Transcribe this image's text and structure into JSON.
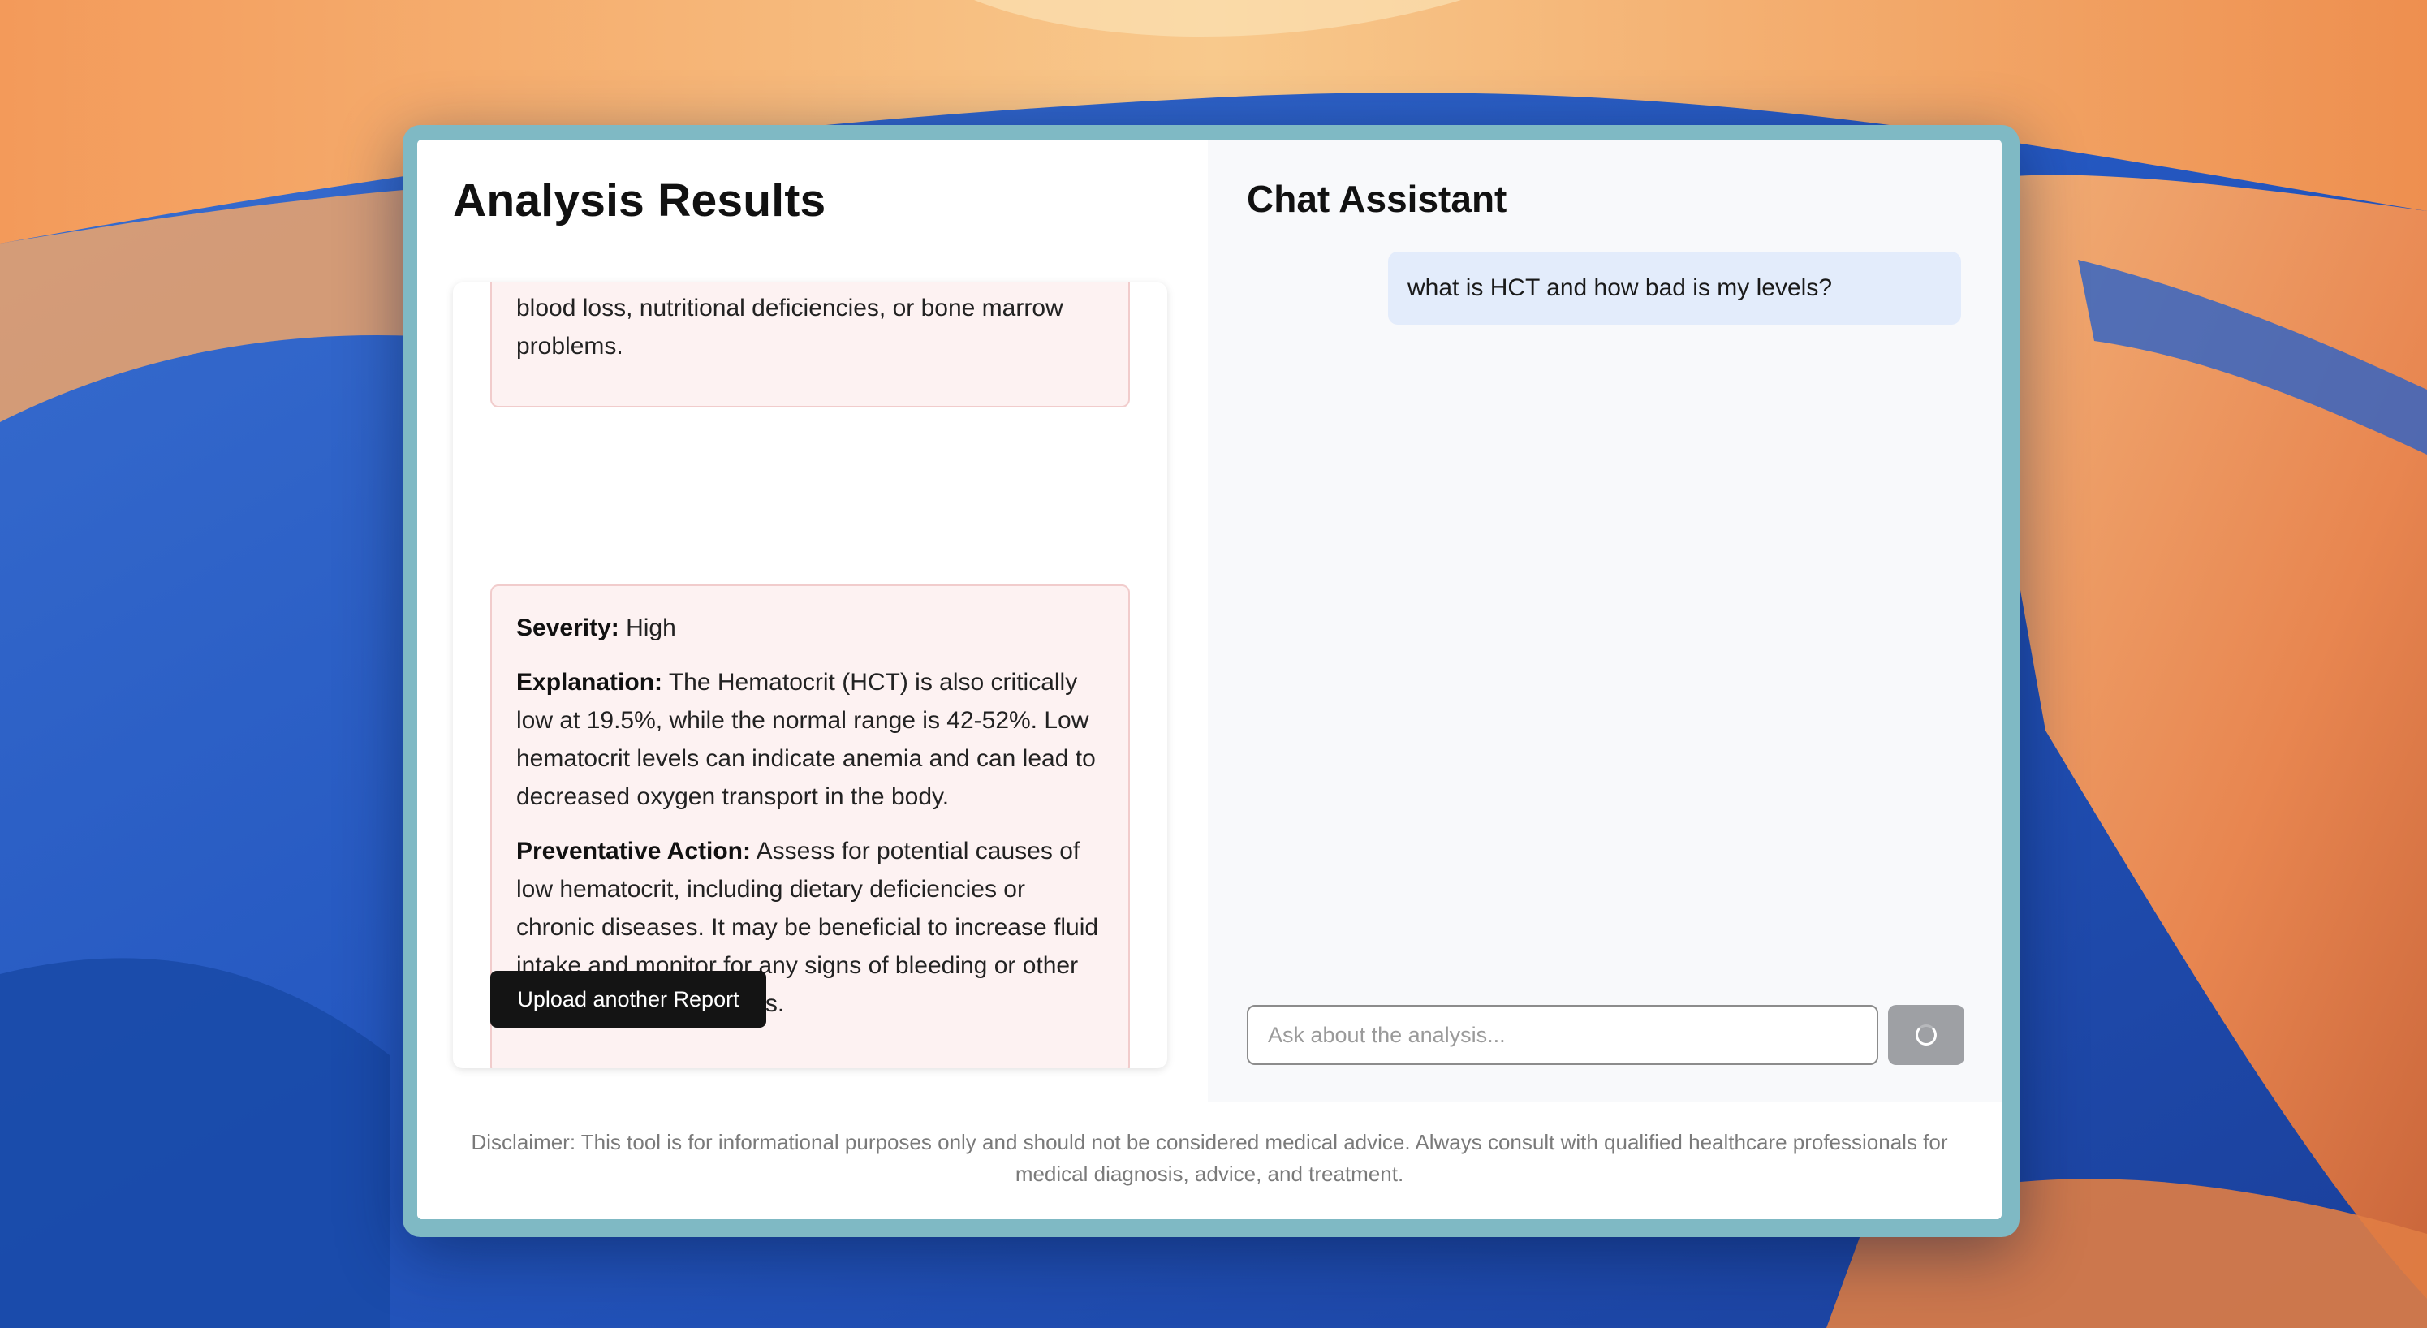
{
  "left_panel": {
    "title": "Analysis Results",
    "card_1": {
      "text": "blood loss, nutritional deficiencies, or bone marrow problems."
    },
    "card_2": {
      "severity_label": "Severity:",
      "severity_value": "High",
      "explanation_label": "Explanation:",
      "explanation_text": "The Hematocrit (HCT) is also critically low at 19.5%, while the normal range is 42-52%. Low hematocrit levels can indicate anemia and can lead to decreased oxygen transport in the body.",
      "action_label": "Preventative Action:",
      "action_text": "Assess for potential causes of low hematocrit, including dietary deficiencies or chronic diseases. It may be beneficial to increase fluid intake and monitor for any signs of bleeding or other underlying health issues."
    },
    "upload_button_label": "Upload another Report"
  },
  "chat": {
    "title": "Chat Assistant",
    "messages": [
      {
        "role": "user",
        "text": "what is HCT and how bad is my levels?"
      }
    ],
    "input_placeholder": "Ask about the analysis...",
    "input_value": "",
    "send_state": "loading"
  },
  "footer": {
    "disclaimer": "Disclaimer: This tool is for informational purposes only and should not be considered medical advice. Always consult with qualified healthcare professionals for medical diagnosis, advice, and treatment."
  },
  "icons": {
    "send": "loading-spinner-icon",
    "cursor": "text-cursor-icon"
  },
  "colors": {
    "card_background": "#fdf2f2",
    "card_border": "#f1cccc",
    "user_bubble": "#e3ecfb",
    "primary_button": "#141414",
    "send_button_disabled": "#9ea0a4",
    "window_frame": "#7fb9c4"
  }
}
